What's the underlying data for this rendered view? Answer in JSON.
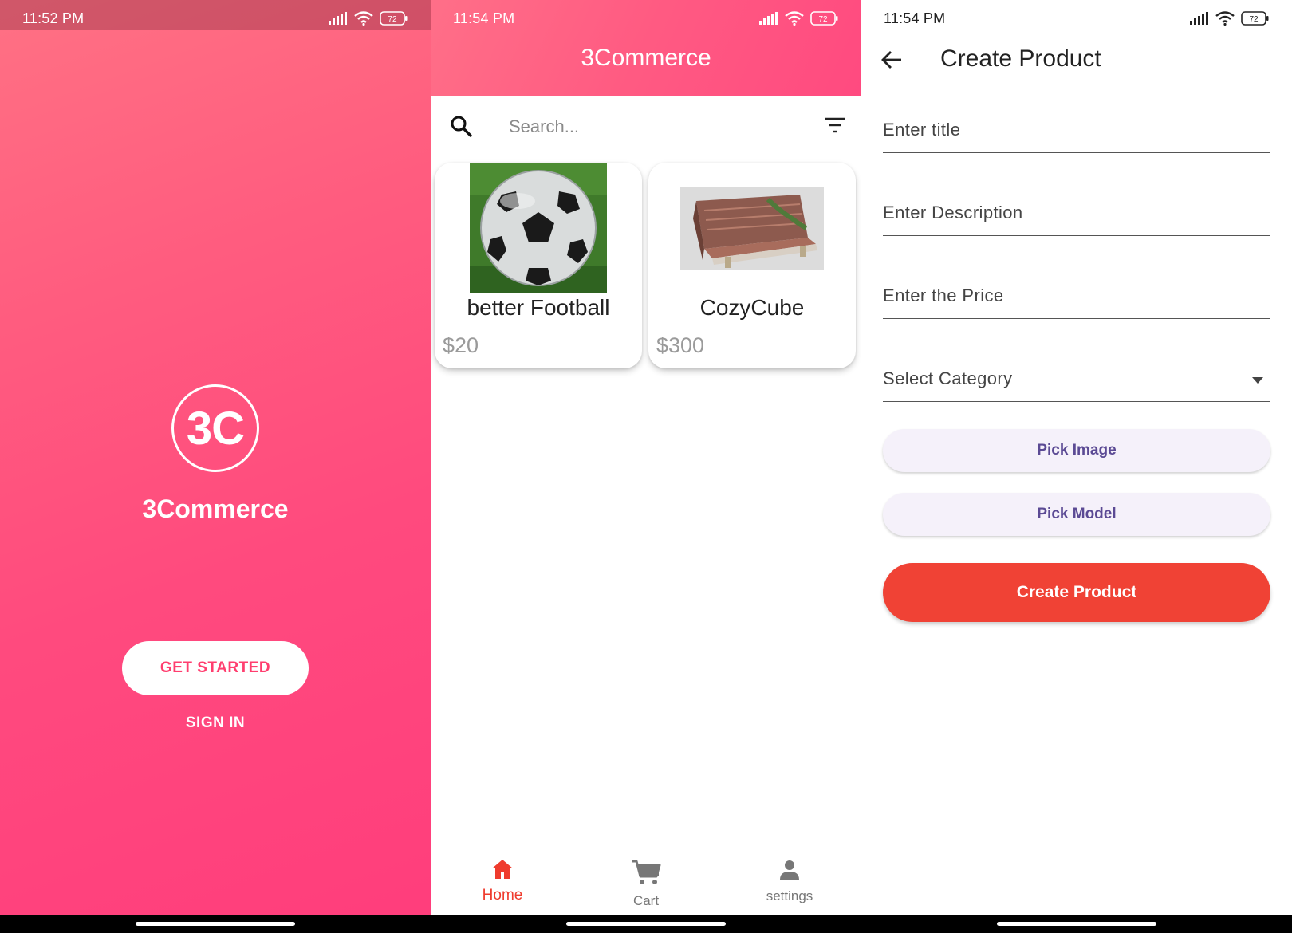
{
  "screens": {
    "welcome": {
      "status_time": "11:52 PM",
      "battery": "72",
      "logo_text": "3C",
      "app_name": "3Commerce",
      "get_started_label": "GET STARTED",
      "sign_in_label": "SIGN IN",
      "icons": [
        "signal-icon",
        "wifi-icon",
        "battery-icon"
      ]
    },
    "home": {
      "status_time": "11:54 PM",
      "battery": "72",
      "title": "3Commerce",
      "search": {
        "placeholder": "Search..."
      },
      "products": [
        {
          "name": "better Football",
          "price": "$20",
          "image": "football-image"
        },
        {
          "name": "CozyCube",
          "price": "$300",
          "image": "sofa-image"
        }
      ],
      "nav": [
        {
          "label": "Home",
          "icon": "home-icon",
          "active": true
        },
        {
          "label": "Cart",
          "icon": "cart-icon",
          "active": false
        },
        {
          "label": "settings",
          "icon": "person-icon",
          "active": false
        }
      ]
    },
    "create": {
      "status_time": "11:54 PM",
      "battery": "72",
      "title": "Create Product",
      "fields": {
        "title_placeholder": "Enter title",
        "description_placeholder": "Enter Description",
        "price_placeholder": "Enter the Price",
        "category_placeholder": "Select Category"
      },
      "pick_image_label": "Pick Image",
      "pick_model_label": "Pick Model",
      "create_button_label": "Create Product"
    }
  },
  "colors": {
    "brand_pink": "#ff4a7e",
    "accent_red": "#f04235",
    "button_text_purple": "#5b4a94"
  }
}
